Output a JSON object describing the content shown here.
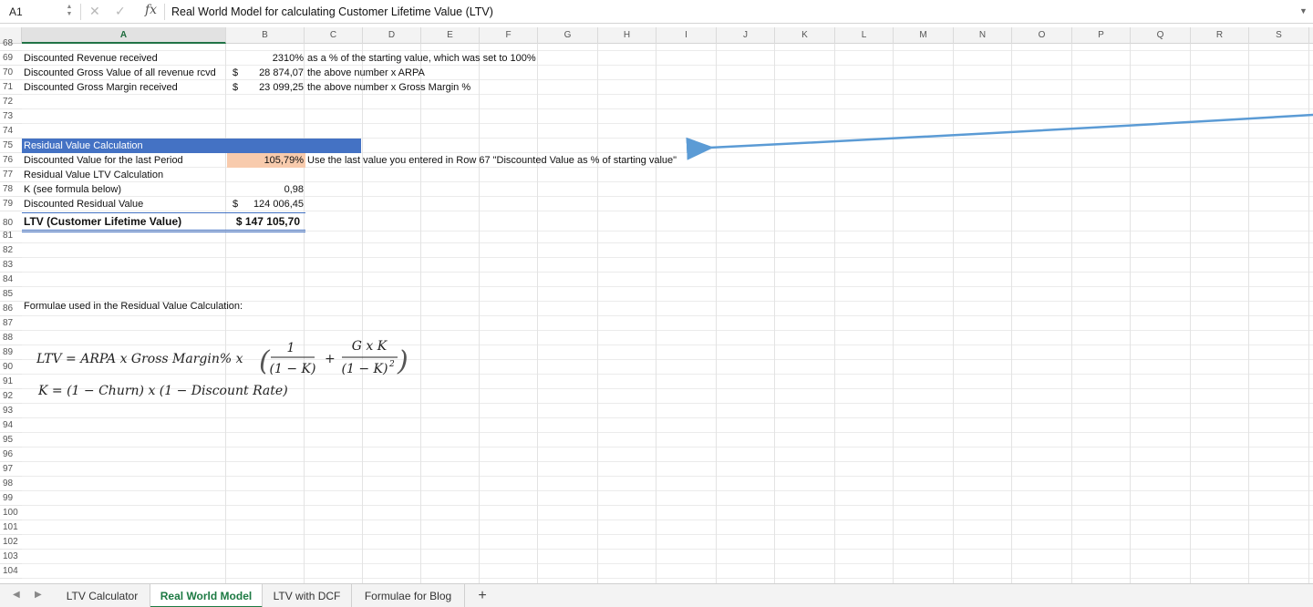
{
  "formula_bar": {
    "name_box": "A1",
    "formula": "Real World Model for calculating Customer Lifetime Value (LTV)",
    "fx_label": "fx"
  },
  "columns": [
    "A",
    "B",
    "C",
    "D",
    "E",
    "F",
    "G",
    "H",
    "I",
    "J",
    "K",
    "L",
    "M",
    "N",
    "O",
    "P",
    "Q",
    "R",
    "S"
  ],
  "rows": [
    "68",
    "69",
    "70",
    "71",
    "72",
    "73",
    "74",
    "75",
    "76",
    "77",
    "78",
    "79",
    "80",
    "81",
    "82",
    "83",
    "84",
    "85",
    "86",
    "87",
    "88",
    "89",
    "90",
    "91",
    "92",
    "93",
    "94",
    "95",
    "96",
    "97",
    "98",
    "99",
    "100",
    "101",
    "102",
    "103",
    "104"
  ],
  "cells": {
    "r69_a": "Discounted Revenue received",
    "r69_b": "2310%",
    "r69_c": "as a % of the starting value, which was set to 100%",
    "r70_a": "Discounted Gross Value of all revenue rcvd",
    "r70_cur": "$",
    "r70_b": "28 874,07",
    "r70_c": "the above number x ARPA",
    "r71_a": "Discounted Gross Margin received",
    "r71_cur": "$",
    "r71_b": "23 099,25",
    "r71_c": "the above number x Gross Margin %",
    "r74_a": "Residual Value Calculation",
    "r75_a": "Discounted Value for the last Period",
    "r75_b": "105,79%",
    "r75_c": "Use the last value you entered in Row 67 \"Discounted Value as % of starting value\"",
    "r76_a": "Residual Value LTV Calculation",
    "r77_a": "K (see formula below)",
    "r77_b": "0,98",
    "r78_a": "Discounted Residual Value",
    "r78_cur": "$",
    "r78_b": "124 006,45",
    "r80_a": "LTV (Customer Lifetime Value)",
    "r80_b": "$ 147 105,70",
    "r85_a": "Formulae used in the Residual Value Calculation:"
  },
  "formula_image": {
    "ltv_lhs": "LTV = ARPA x Gross Margin% x",
    "frac1_num": "1",
    "frac1_den": "(1 − K)",
    "plus": "+",
    "frac2_num": "G x K",
    "frac2_den": "(1 − K)",
    "frac2_exp": "2",
    "k_line": "K =  (1 − Churn) x (1 − Discount Rate)"
  },
  "sheet_tabs": [
    "LTV Calculator",
    "Real World Model",
    "LTV with DCF",
    "Formulae for Blog"
  ],
  "active_tab": "Real World Model",
  "add_sheet_label": "+",
  "colors": {
    "header_band": "#4472c4",
    "input_cell": "#f8cbad",
    "active_tab_text": "#1d7a43",
    "arrow": "#5b9bd5"
  }
}
